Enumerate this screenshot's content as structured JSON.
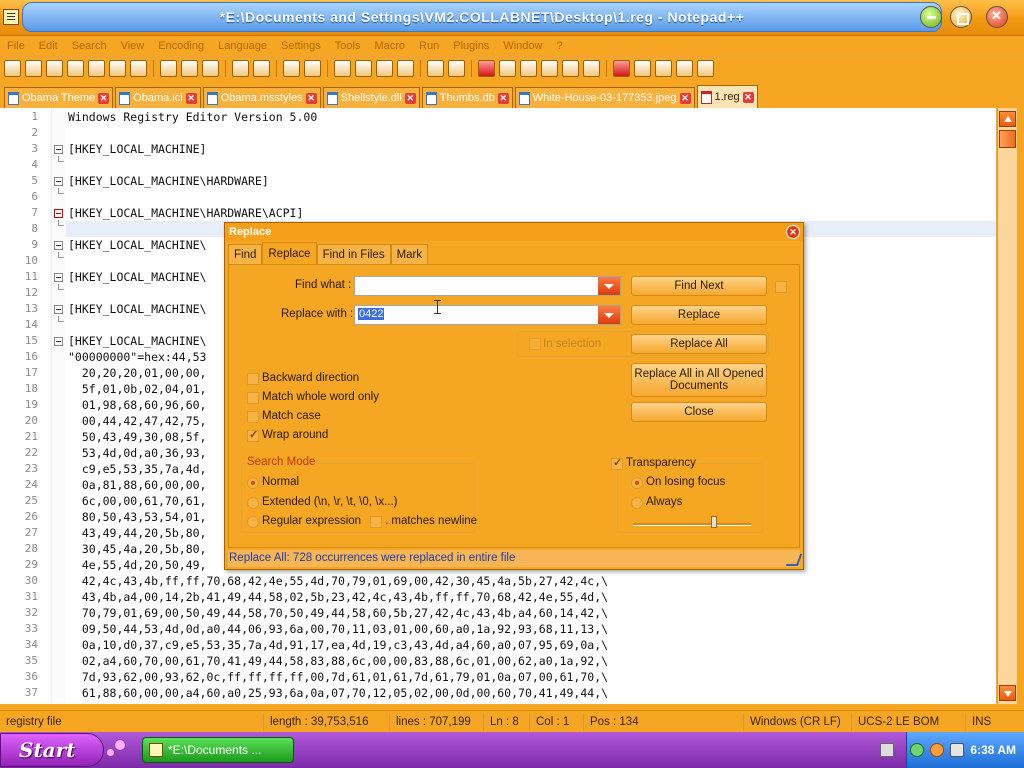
{
  "window": {
    "title": "*E:\\Documents and Settings\\VM2.COLLABNET\\Desktop\\1.reg - Notepad++"
  },
  "menu": [
    "File",
    "Edit",
    "Search",
    "View",
    "Encoding",
    "Language",
    "Settings",
    "Tools",
    "Macro",
    "Run",
    "Plugins",
    "Window",
    "?"
  ],
  "tabs": [
    {
      "label": "Obama Theme"
    },
    {
      "label": "Obama.icl"
    },
    {
      "label": "Obama.msstyles"
    },
    {
      "label": "Shellstyle.dll"
    },
    {
      "label": "Thumbs.db"
    },
    {
      "label": "White-House-03-177353.jpeg"
    },
    {
      "label": "1.reg",
      "active": true
    }
  ],
  "editor": {
    "lines": [
      {
        "n": "1",
        "text": "Windows Registry Editor Version 5.00"
      },
      {
        "n": "2",
        "text": ""
      },
      {
        "n": "3",
        "text": "[HKEY_LOCAL_MACHINE]"
      },
      {
        "n": "4",
        "text": ""
      },
      {
        "n": "5",
        "text": "[HKEY_LOCAL_MACHINE\\HARDWARE]"
      },
      {
        "n": "6",
        "text": ""
      },
      {
        "n": "7",
        "text": "[HKEY_LOCAL_MACHINE\\HARDWARE\\ACPI]"
      },
      {
        "n": "8",
        "text": ""
      },
      {
        "n": "9",
        "text": "[HKEY_LOCAL_MACHINE\\"
      },
      {
        "n": "10",
        "text": ""
      },
      {
        "n": "11",
        "text": "[HKEY_LOCAL_MACHINE\\"
      },
      {
        "n": "12",
        "text": ""
      },
      {
        "n": "13",
        "text": "[HKEY_LOCAL_MACHINE\\"
      },
      {
        "n": "14",
        "text": ""
      },
      {
        "n": "15",
        "text": "[HKEY_LOCAL_MACHINE\\"
      },
      {
        "n": "16",
        "text": "\"00000000\"=hex:44,53"
      },
      {
        "n": "17",
        "text": "  20,20,20,01,00,00,"
      },
      {
        "n": "18",
        "text": "  5f,01,0b,02,04,01,"
      },
      {
        "n": "19",
        "text": "  01,98,68,60,96,60,"
      },
      {
        "n": "20",
        "text": "  00,44,42,47,42,75,"
      },
      {
        "n": "21",
        "text": "  50,43,49,30,08,5f,"
      },
      {
        "n": "22",
        "text": "  53,4d,0d,a0,36,93,"
      },
      {
        "n": "23",
        "text": "  c9,e5,53,35,7a,4d,"
      },
      {
        "n": "24",
        "text": "  0a,81,88,60,00,00,"
      },
      {
        "n": "25",
        "text": "  6c,00,00,61,70,61,"
      },
      {
        "n": "26",
        "text": "  80,50,43,53,54,01,"
      },
      {
        "n": "27",
        "text": "  43,49,44,20,5b,80,"
      },
      {
        "n": "28",
        "text": "  30,45,4a,20,5b,80,"
      },
      {
        "n": "29",
        "text": "  4e,55,4d,20,50,49,"
      },
      {
        "n": "30",
        "text": "  42,4c,43,4b,ff,ff,70,68,42,4e,55,4d,70,79,01,69,00,42,30,45,4a,5b,27,42,4c,\\"
      },
      {
        "n": "31",
        "text": "  43,4b,a4,00,14,2b,41,49,44,58,02,5b,23,42,4c,43,4b,ff,ff,70,68,42,4e,55,4d,\\"
      },
      {
        "n": "32",
        "text": "  70,79,01,69,00,50,49,44,58,70,50,49,44,58,60,5b,27,42,4c,43,4b,a4,60,14,42,\\"
      },
      {
        "n": "33",
        "text": "  09,50,44,53,4d,0d,a0,44,06,93,6a,00,70,11,03,01,00,60,a0,1a,92,93,68,11,13,\\"
      },
      {
        "n": "34",
        "text": "  0a,10,d0,37,c9,e5,53,35,7a,4d,91,17,ea,4d,19,c3,43,4d,a4,60,a0,07,95,69,0a,\\"
      },
      {
        "n": "35",
        "text": "  02,a4,60,70,00,61,70,41,49,44,58,83,88,6c,00,00,83,88,6c,01,00,62,a0,1a,92,\\"
      },
      {
        "n": "36",
        "text": "  7d,93,62,00,93,62,0c,ff,ff,ff,ff,00,7d,61,01,61,7d,61,79,01,0a,07,00,61,70,\\"
      },
      {
        "n": "37",
        "text": "  61,88,60,00,00,a4,60,a0,25,93,6a,0a,07,70,12,05,02,00,0d,00,60,70,41,49,44,\\"
      }
    ]
  },
  "dialog": {
    "title": "Replace",
    "tabs": [
      "Find",
      "Replace",
      "Find in Files",
      "Mark"
    ],
    "find_label": "Find what :",
    "find_value": "",
    "replace_label": "Replace with :",
    "replace_value": "0422",
    "buttons": {
      "find_next": "Find Next",
      "replace": "Replace",
      "replace_all": "Replace All",
      "replace_all_docs": "Replace All in All Opened Documents",
      "close": "Close"
    },
    "in_selection": "In selection",
    "options": [
      {
        "label": "Backward direction",
        "checked": false
      },
      {
        "label": "Match whole word only",
        "checked": false
      },
      {
        "label": "Match case",
        "checked": false
      },
      {
        "label": "Wrap around",
        "checked": true
      }
    ],
    "search_mode": {
      "title": "Search Mode",
      "normal": "Normal",
      "extended": "Extended (\\n, \\r, \\t, \\0, \\x...)",
      "regex": "Regular expression",
      "matches_newline": ". matches newline"
    },
    "transparency": {
      "title": "Transparency",
      "on_losing_focus": "On losing focus",
      "always": "Always",
      "level": 0.7
    },
    "status": "Replace All: 728 occurrences were replaced in entire file"
  },
  "statusbar": {
    "type": "registry file",
    "length": "length : 39,753,516",
    "lines": "lines : 707,199",
    "ln": "Ln : 8",
    "col": "Col : 1",
    "pos": "Pos : 134",
    "eol": "Windows (CR LF)",
    "encoding": "UCS-2 LE BOM",
    "mode": "INS"
  },
  "taskbar": {
    "start": "Start",
    "task": "*E:\\Documents ...",
    "clock": "6:38 AM"
  }
}
